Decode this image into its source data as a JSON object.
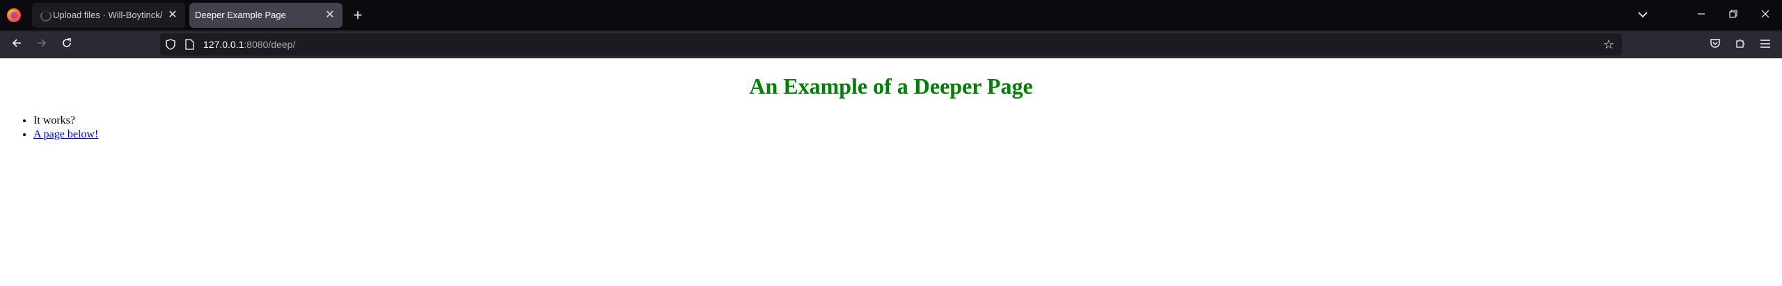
{
  "tabs": [
    {
      "label": "Upload files · Will-Boytinck/Ch",
      "active": false,
      "loading": true
    },
    {
      "label": "Deeper Example Page",
      "active": true,
      "loading": false
    }
  ],
  "navbar": {
    "url_host": "127.0.0.1",
    "url_rest": ":8080/deep/"
  },
  "page": {
    "heading": "An Example of a Deeper Page",
    "heading_color": "#008000",
    "items": [
      {
        "text": "It works?",
        "link": false
      },
      {
        "text": "A page below!",
        "link": true
      }
    ]
  },
  "colors": {
    "tabstrip_bg": "#0b0b0f",
    "toolbar_bg": "#2b2a33",
    "link": "#0000ee"
  },
  "icons": {
    "firefox": "firefox-logo-icon",
    "new_tab": "plus-icon",
    "back": "arrow-left-icon",
    "forward": "arrow-right-icon",
    "reload": "reload-icon",
    "tracking": "shield-icon",
    "page": "page-icon",
    "bookmark": "star-icon",
    "pocket": "pocket-icon",
    "extensions": "puzzle-icon",
    "menu": "hamburger-menu-icon"
  }
}
